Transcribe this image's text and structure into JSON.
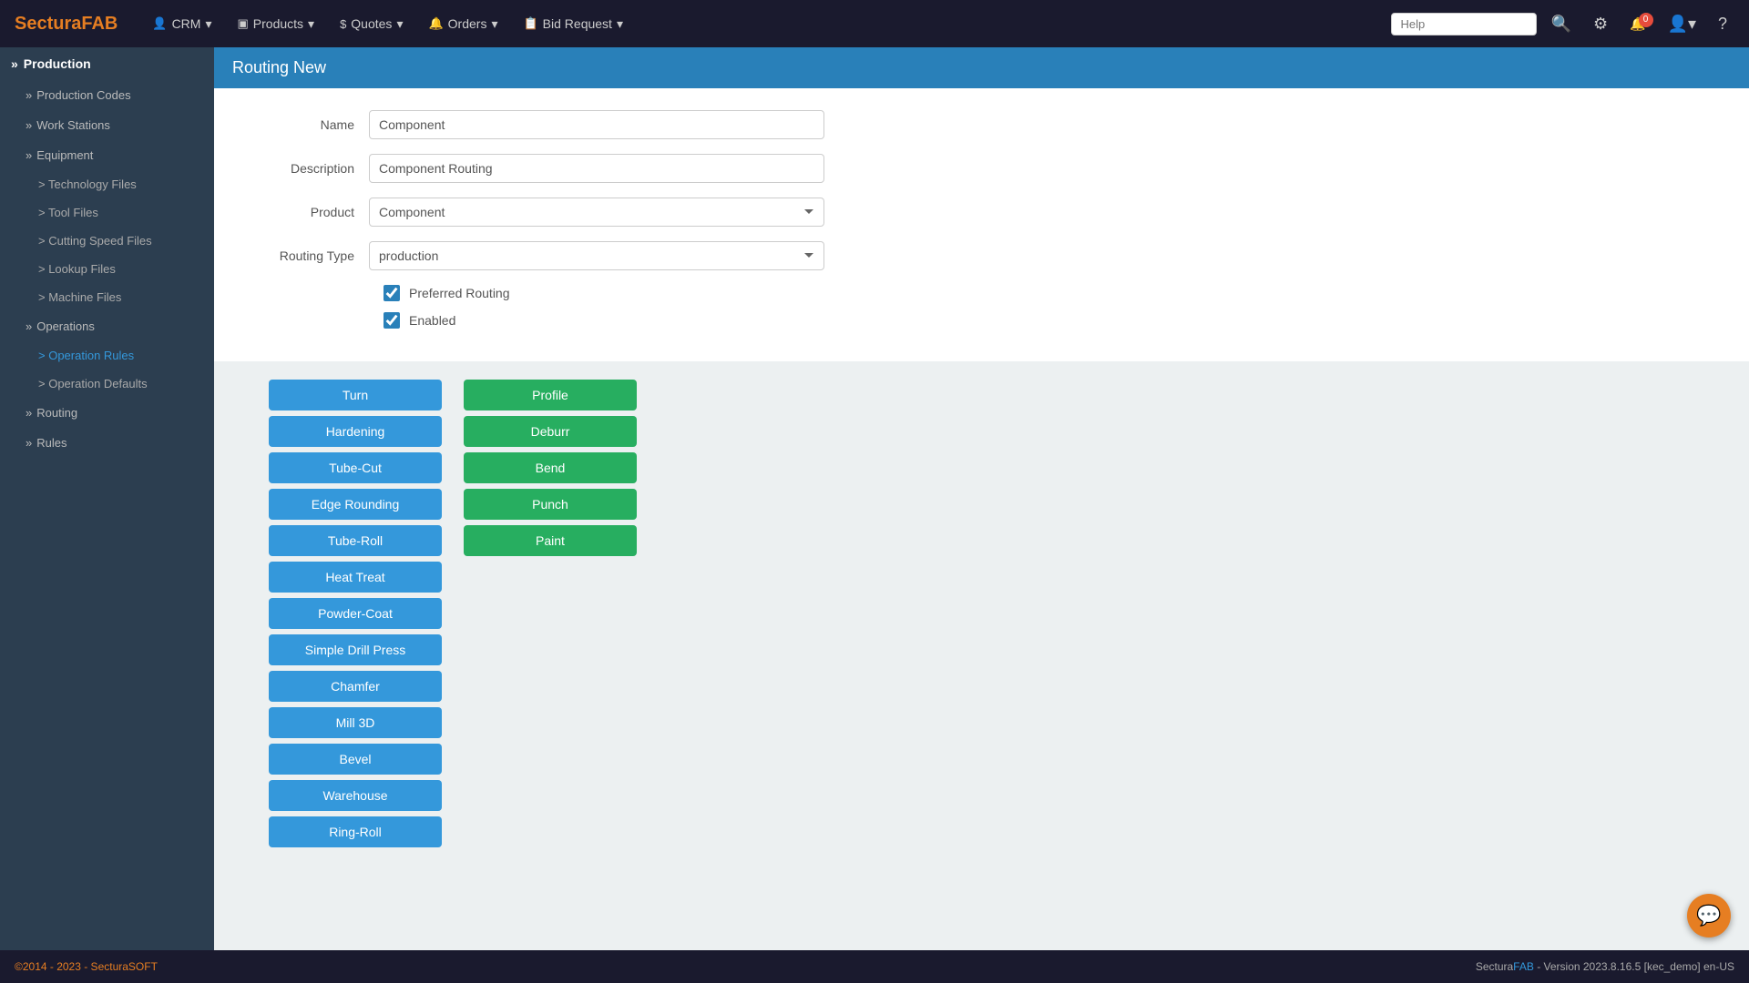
{
  "brand": {
    "name_start": "Sectura",
    "name_end": "FAB"
  },
  "navbar": {
    "items": [
      {
        "id": "crm",
        "icon": "👤",
        "label": "CRM",
        "has_dropdown": true
      },
      {
        "id": "products",
        "icon": "▣",
        "label": "Products",
        "has_dropdown": true
      },
      {
        "id": "quotes",
        "icon": "$",
        "label": "Quotes",
        "has_dropdown": true
      },
      {
        "id": "orders",
        "icon": "🔔",
        "label": "Orders",
        "has_dropdown": true
      },
      {
        "id": "bid-request",
        "icon": "📋",
        "label": "Bid Request",
        "has_dropdown": true
      }
    ],
    "search_placeholder": "Help",
    "notification_count": "0"
  },
  "sidebar": {
    "section_label": "Production",
    "items": [
      {
        "id": "production-codes",
        "label": "Production Codes",
        "indent": 1
      },
      {
        "id": "work-stations",
        "label": "Work Stations",
        "indent": 1
      },
      {
        "id": "equipment",
        "label": "Equipment",
        "indent": 1,
        "expandable": true
      },
      {
        "id": "technology-files",
        "label": "Technology Files",
        "indent": 2
      },
      {
        "id": "tool-files",
        "label": "Tool Files",
        "indent": 2
      },
      {
        "id": "cutting-speed-files",
        "label": "Cutting Speed Files",
        "indent": 2
      },
      {
        "id": "lookup-files",
        "label": "Lookup Files",
        "indent": 2
      },
      {
        "id": "machine-files",
        "label": "Machine Files",
        "indent": 2
      },
      {
        "id": "operations",
        "label": "Operations",
        "indent": 1,
        "expandable": true
      },
      {
        "id": "operation-rules",
        "label": "> Operation Rules",
        "indent": 2,
        "active": true
      },
      {
        "id": "operation-defaults",
        "label": "Operation Defaults",
        "indent": 2
      },
      {
        "id": "routing",
        "label": "Routing",
        "indent": 1,
        "expandable": true
      },
      {
        "id": "rules",
        "label": "Rules",
        "indent": 1,
        "expandable": true
      }
    ]
  },
  "page": {
    "title": "Routing New"
  },
  "form": {
    "name_label": "Name",
    "name_value": "Component",
    "description_label": "Description",
    "description_value": "Component Routing",
    "product_label": "Product",
    "product_value": "Component",
    "routing_type_label": "Routing Type",
    "routing_type_value": "production",
    "preferred_routing_label": "Preferred Routing",
    "enabled_label": "Enabled"
  },
  "blue_buttons": [
    "Turn",
    "Hardening",
    "Tube-Cut",
    "Edge Rounding",
    "Tube-Roll",
    "Heat Treat",
    "Powder-Coat",
    "Simple Drill Press",
    "Chamfer",
    "Mill 3D",
    "Bevel",
    "Warehouse",
    "Ring-Roll"
  ],
  "green_buttons": [
    "Profile",
    "Deburr",
    "Bend",
    "Punch",
    "Paint"
  ],
  "footer": {
    "left": "©2014 - 2023 - SecturaSOFT",
    "right_prefix": "Sectura",
    "right_brand": "FAB",
    "right_suffix": " - Version 2023.8.16.5 [kec_demo] en-US"
  }
}
